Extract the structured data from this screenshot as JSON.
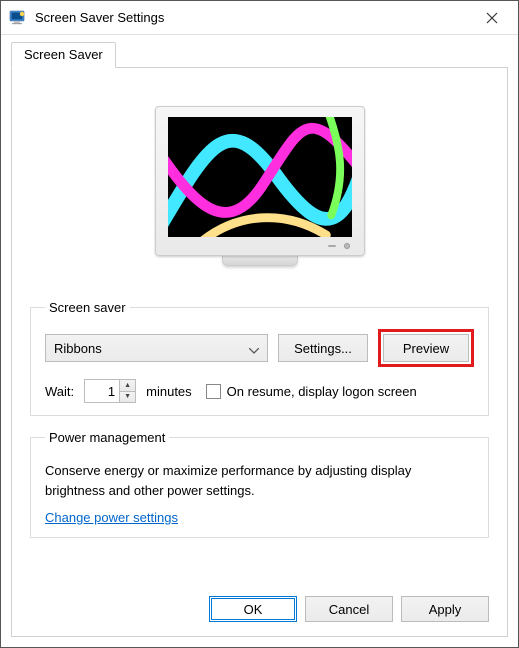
{
  "window": {
    "title": "Screen Saver Settings"
  },
  "tabs": {
    "screensaver": "Screen Saver"
  },
  "group_screensaver": {
    "legend": "Screen saver",
    "selected": "Ribbons",
    "settings_button": "Settings...",
    "preview_button": "Preview",
    "wait_label": "Wait:",
    "wait_value": "1",
    "wait_unit": "minutes",
    "on_resume_label": "On resume, display logon screen",
    "on_resume_checked": false
  },
  "group_power": {
    "legend": "Power management",
    "text": "Conserve energy or maximize performance by adjusting display brightness and other power settings.",
    "link": "Change power settings"
  },
  "dialog_buttons": {
    "ok": "OK",
    "cancel": "Cancel",
    "apply": "Apply"
  }
}
